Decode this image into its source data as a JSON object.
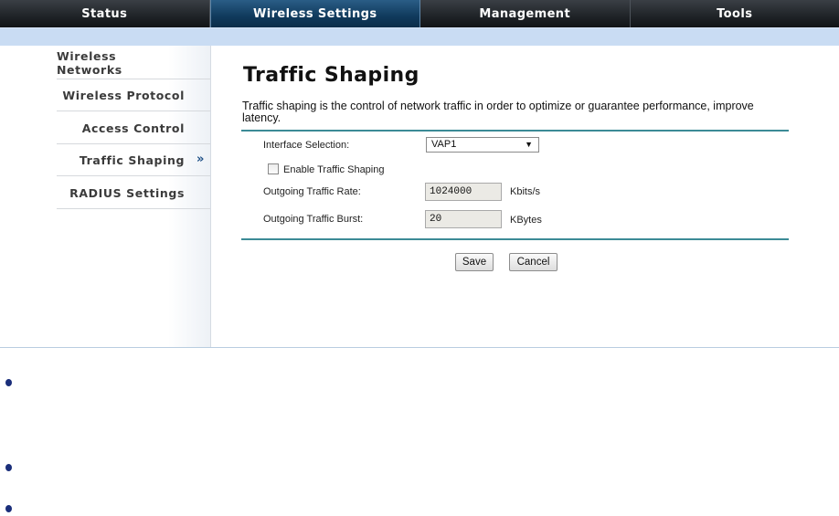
{
  "topnav": {
    "tabs": [
      {
        "label": "Status"
      },
      {
        "label": "Wireless Settings"
      },
      {
        "label": "Management"
      },
      {
        "label": "Tools"
      }
    ],
    "active_tab": "Wireless Settings"
  },
  "sidebar": {
    "items": [
      {
        "label": "Wireless Networks"
      },
      {
        "label": "Wireless Protocol"
      },
      {
        "label": "Access Control"
      },
      {
        "label": "Traffic Shaping"
      },
      {
        "label": "RADIUS Settings"
      }
    ],
    "active_item": "Traffic Shaping",
    "active_marker": "»"
  },
  "main": {
    "title": "Traffic Shaping",
    "description": "Traffic shaping is the control of network traffic in order to optimize or guarantee performance, improve latency.",
    "interface_label": "Interface Selection:",
    "interface_value": "VAP1",
    "dropdown_arrow": "▼",
    "enable_label": "Enable Traffic Shaping",
    "enable_checked": false,
    "rate_label": "Outgoing Traffic Rate:",
    "rate_value": "1024000",
    "rate_unit": "Kbits/s",
    "burst_label": "Outgoing Traffic Burst:",
    "burst_value": "20",
    "burst_unit": "KBytes",
    "save_label": "Save",
    "cancel_label": "Cancel"
  },
  "colors": {
    "accent_rule": "#3c8b96",
    "active_tab": "#103a5c",
    "subbar": "#c9dcf3",
    "bullet": "#1a2e7a"
  }
}
